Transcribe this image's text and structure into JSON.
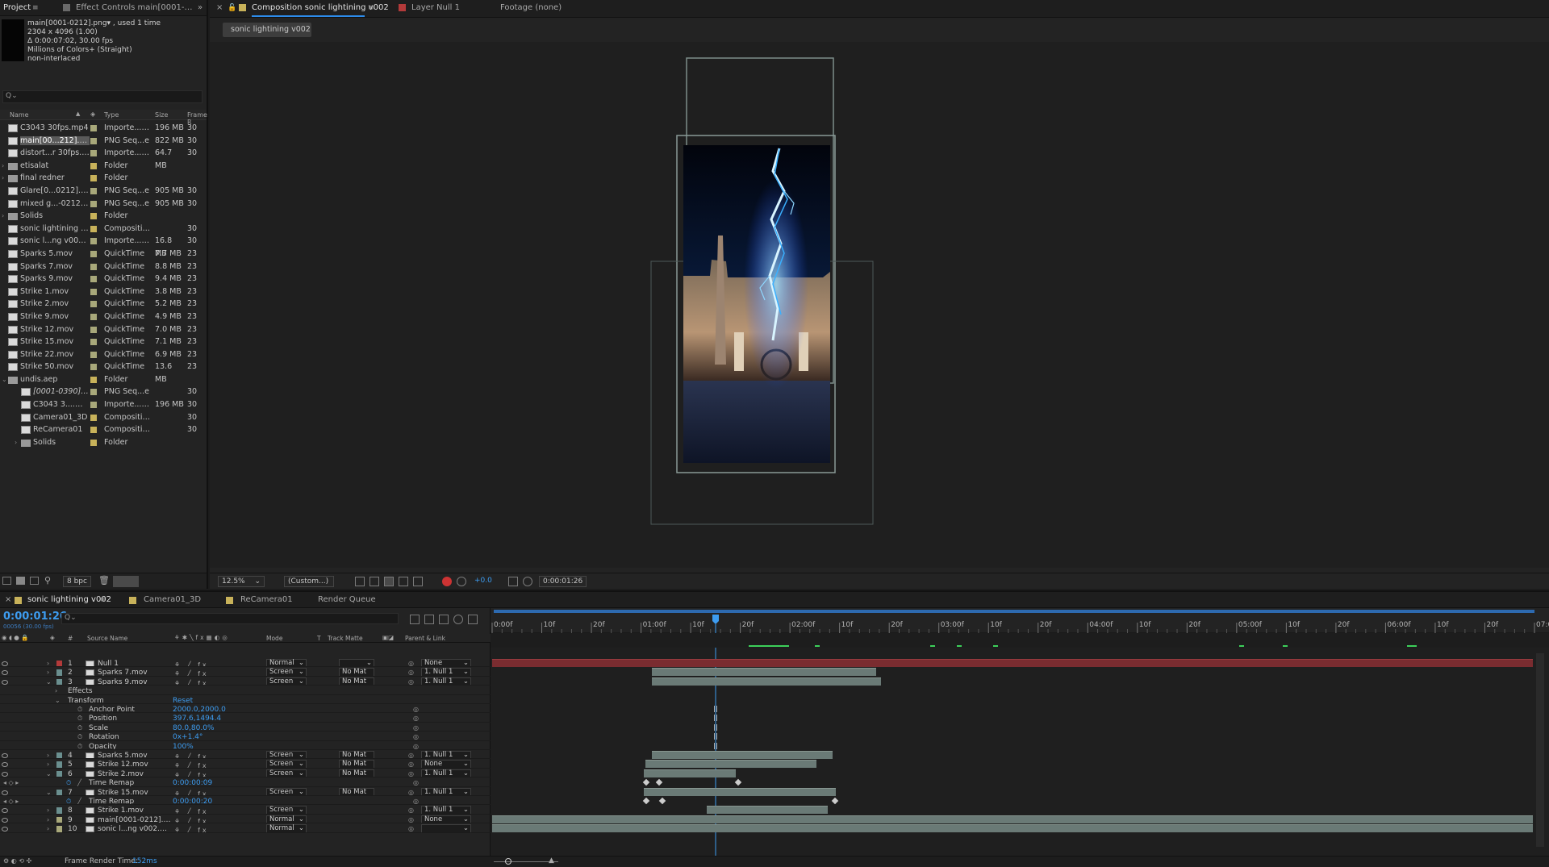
{
  "project_panel": {
    "tabs": [
      "Project",
      "Effect Controls main[0001-0212].png",
      "»"
    ],
    "selected_meta": {
      "name": "main[0001-0212].png▾ , used 1 time",
      "size": "2304 x 4096 (1.00)",
      "duration": "Δ 0:00:07:02, 30.00 fps",
      "colors": "Millions of Colors+ (Straight)",
      "interlace": "non-interlaced"
    },
    "search_placeholder": "Q⌄",
    "columns": {
      "name": "Name",
      "type": "Type",
      "size": "Size",
      "frame": "Frame R"
    },
    "items": [
      {
        "name": "C3043 30fps.mp4",
        "type": "Importe...MEX",
        "size": "196 MB",
        "frame": "30",
        "color": "#a8a87a",
        "kind": "file"
      },
      {
        "name": "main[00...212].png",
        "type": "PNG Seq...e",
        "size": "822 MB",
        "frame": "30",
        "color": "#a8a87a",
        "kind": "file",
        "selected": true
      },
      {
        "name": "distort...r 30fps.mp4",
        "type": "Importe...MEX",
        "size": "64.7 MB",
        "frame": "30",
        "color": "#a8a87a",
        "kind": "file"
      },
      {
        "name": "etisalat",
        "type": "Folder",
        "size": "",
        "frame": "",
        "color": "#c8b25a",
        "kind": "folder"
      },
      {
        "name": "final redner",
        "type": "Folder",
        "size": "",
        "frame": "",
        "color": "#c8b25a",
        "kind": "folder"
      },
      {
        "name": "Glare[0...0212].png",
        "type": "PNG Seq...e",
        "size": "905 MB",
        "frame": "30",
        "color": "#a8a87a",
        "kind": "file"
      },
      {
        "name": "mixed g...-0212].png",
        "type": "PNG Seq...e",
        "size": "905 MB",
        "frame": "30",
        "color": "#a8a87a",
        "kind": "file"
      },
      {
        "name": "Solids",
        "type": "Folder",
        "size": "",
        "frame": "",
        "color": "#c8b25a",
        "kind": "folder"
      },
      {
        "name": "sonic lightining v002",
        "type": "Composition",
        "size": "",
        "frame": "30",
        "color": "#c8b25a",
        "kind": "comp"
      },
      {
        "name": "sonic l...ng v002.mp4",
        "type": "Importe...MEX",
        "size": "16.8 MB",
        "frame": "30",
        "color": "#a8a87a",
        "kind": "file"
      },
      {
        "name": "Sparks 5.mov",
        "type": "QuickTime",
        "size": "7.7 MB",
        "frame": "23",
        "color": "#a8a87a",
        "kind": "file"
      },
      {
        "name": "Sparks 7.mov",
        "type": "QuickTime",
        "size": "8.8 MB",
        "frame": "23",
        "color": "#a8a87a",
        "kind": "file"
      },
      {
        "name": "Sparks 9.mov",
        "type": "QuickTime",
        "size": "9.4 MB",
        "frame": "23",
        "color": "#a8a87a",
        "kind": "file"
      },
      {
        "name": "Strike 1.mov",
        "type": "QuickTime",
        "size": "3.8 MB",
        "frame": "23",
        "color": "#a8a87a",
        "kind": "file"
      },
      {
        "name": "Strike 2.mov",
        "type": "QuickTime",
        "size": "5.2 MB",
        "frame": "23",
        "color": "#a8a87a",
        "kind": "file"
      },
      {
        "name": "Strike 9.mov",
        "type": "QuickTime",
        "size": "4.9 MB",
        "frame": "23",
        "color": "#a8a87a",
        "kind": "file"
      },
      {
        "name": "Strike 12.mov",
        "type": "QuickTime",
        "size": "7.0 MB",
        "frame": "23",
        "color": "#a8a87a",
        "kind": "file"
      },
      {
        "name": "Strike 15.mov",
        "type": "QuickTime",
        "size": "7.1 MB",
        "frame": "23",
        "color": "#a8a87a",
        "kind": "file"
      },
      {
        "name": "Strike 22.mov",
        "type": "QuickTime",
        "size": "6.9 MB",
        "frame": "23",
        "color": "#a8a87a",
        "kind": "file"
      },
      {
        "name": "Strike 50.mov",
        "type": "QuickTime",
        "size": "13.6 MB",
        "frame": "23",
        "color": "#a8a87a",
        "kind": "file"
      },
      {
        "name": "undis.aep",
        "type": "Folder",
        "size": "",
        "frame": "",
        "color": "#c8b25a",
        "kind": "folder",
        "open": true
      },
      {
        "name": "[0001-0390].png",
        "type": "PNG Seq...e",
        "size": "",
        "frame": "30",
        "color": "#a8a87a",
        "kind": "file",
        "indent": 1,
        "italic": true
      },
      {
        "name": "C3043 3....mp4",
        "type": "Importe...MEX",
        "size": "196 MB",
        "frame": "30",
        "color": "#a8a87a",
        "kind": "file",
        "indent": 1
      },
      {
        "name": "Camera01_3D",
        "type": "Composition",
        "size": "",
        "frame": "30",
        "color": "#c8b25a",
        "kind": "comp",
        "indent": 1
      },
      {
        "name": "ReCamera01",
        "type": "Composition",
        "size": "",
        "frame": "30",
        "color": "#c8b25a",
        "kind": "comp",
        "indent": 1
      },
      {
        "name": "Solids",
        "type": "Folder",
        "size": "",
        "frame": "",
        "color": "#c8b25a",
        "kind": "folder",
        "indent": 1
      }
    ],
    "footer_bpc": "8 bpc"
  },
  "viewer": {
    "tabs": [
      "Composition sonic lightining v002",
      "Layer Null 1",
      "Footage (none)"
    ],
    "comp_chip": "sonic lightining v002",
    "zoom": "12.5%",
    "view": "(Custom...)",
    "exposure": "+0.0",
    "timecode": "0:00:01:26"
  },
  "timeline": {
    "tabs": [
      "sonic lightining v002",
      "Camera01_3D",
      "ReCamera01",
      "Render Queue"
    ],
    "current_time": "0:00:01:26",
    "current_frame": "00056 (30.00 fps)",
    "search_placeholder": "Q⌄",
    "columns": {
      "num": "#",
      "source": "Source Name",
      "mode": "Mode",
      "t": "T",
      "matte": "Track Matte",
      "parent": "Parent & Link"
    },
    "ruler": [
      "0:00f",
      "10f",
      "20f",
      "01:00f",
      "10f",
      "20f",
      "02:00f",
      "10f",
      "20f",
      "03:00f",
      "10f",
      "20f",
      "04:00f",
      "10f",
      "20f",
      "05:00f",
      "10f",
      "20f",
      "06:00f",
      "10f",
      "20f",
      "07:00"
    ],
    "layers": [
      {
        "num": "1",
        "name": "Null 1",
        "mode": "Normal",
        "matte": "",
        "parent": "None",
        "color": "#b33a3a",
        "icon": "null"
      },
      {
        "num": "2",
        "name": "Sparks 7.mov",
        "mode": "Screen",
        "matte": "No Mat",
        "parent": "1. Null 1",
        "color": "#6a8f8f",
        "icon": "file"
      },
      {
        "num": "3",
        "name": "Sparks 9.mov",
        "mode": "Screen",
        "matte": "No Mat",
        "parent": "1. Null 1",
        "color": "#6a8f8f",
        "icon": "file",
        "open": true
      }
    ],
    "effects_label": "Effects",
    "transform_label": "Transform",
    "reset_label": "Reset",
    "properties": [
      {
        "name": "Anchor Point",
        "value": "2000.0,2000.0"
      },
      {
        "name": "Position",
        "value": "397.6,1494.4"
      },
      {
        "name": "Scale",
        "value": "80.0,80.0%"
      },
      {
        "name": "Rotation",
        "value": "0x+1.4°"
      },
      {
        "name": "Opacity",
        "value": "100%"
      }
    ],
    "layers2": [
      {
        "num": "4",
        "name": "Sparks 5.mov",
        "mode": "Screen",
        "matte": "No Mat",
        "parent": "1. Null 1"
      },
      {
        "num": "5",
        "name": "Strike 12.mov",
        "mode": "Screen",
        "matte": "No Mat",
        "parent": "None"
      },
      {
        "num": "6",
        "name": "Strike 2.mov",
        "mode": "Screen",
        "matte": "No Mat",
        "parent": "1. Null 1"
      }
    ],
    "time_remap_label": "Time Remap",
    "time_remap_6": "0:00:00:09",
    "layer7": {
      "num": "7",
      "name": "Strike 15.mov",
      "mode": "Screen",
      "matte": "No Mat",
      "parent": "1. Null 1"
    },
    "time_remap_7": "0:00:00:20",
    "layers3": [
      {
        "num": "8",
        "name": "Strike 1.mov",
        "mode": "Screen",
        "matte": "",
        "parent": "1. Null 1"
      },
      {
        "num": "9",
        "name": "main[0001-0212].png",
        "mode": "Normal",
        "matte": "",
        "parent": "None"
      },
      {
        "num": "10",
        "name": "sonic l...ng v002.mp4",
        "mode": "Normal",
        "matte": "",
        "parent": ""
      }
    ],
    "render_time_label": "Frame Render Time:",
    "render_time_value": "152ms"
  },
  "colors": {
    "accent": "#2d8ceb",
    "null_bar": "#7a2c30",
    "layer_bar": "#6a7a76"
  }
}
